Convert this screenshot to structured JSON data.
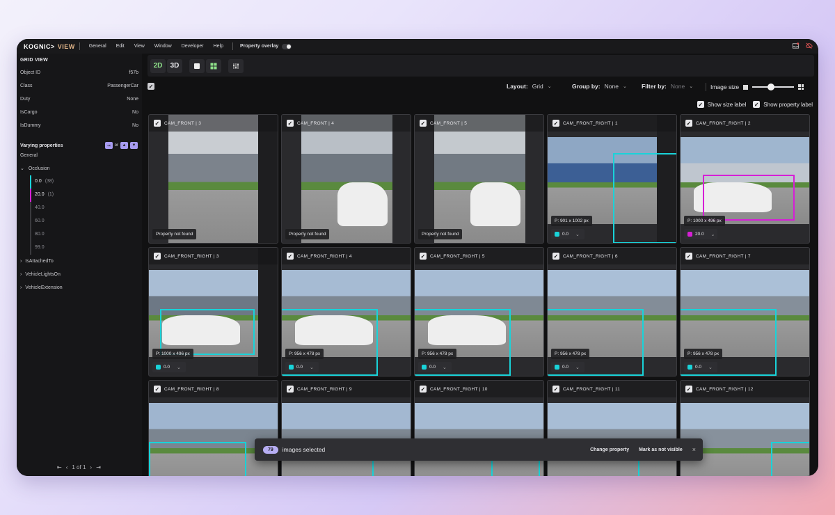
{
  "menubar": {
    "logo": "KOGNIC",
    "logo_suffix": "VIEW",
    "items": [
      "General",
      "Edit",
      "View",
      "Window",
      "Developer",
      "Help"
    ],
    "overlay_label": "Property overlay",
    "overlay_on": false
  },
  "sidebar": {
    "title": "GRID VIEW",
    "properties": [
      {
        "key": "Object ID",
        "value": "f57b"
      },
      {
        "key": "Class",
        "value": "PassengerCar"
      },
      {
        "key": "Duty",
        "value": "None"
      },
      {
        "key": "IsCargo",
        "value": "No"
      },
      {
        "key": "IsDummy",
        "value": "No"
      }
    ],
    "varying_title": "Varying properties",
    "or_label": "or",
    "group_label": "General",
    "occlusion_label": "Occlusion",
    "occlusion_values": [
      {
        "value": "0.0",
        "count": "(38)",
        "color": "#19d3d9"
      },
      {
        "value": "20.0",
        "count": "(1)",
        "color": "#d61fd6"
      },
      {
        "value": "40.0",
        "count": ""
      },
      {
        "value": "60.0",
        "count": ""
      },
      {
        "value": "80.0",
        "count": ""
      },
      {
        "value": "99.0",
        "count": ""
      }
    ],
    "collapsed_groups": [
      "IsAttachedTo",
      "VehicleLightsOn",
      "VehicleExtension"
    ],
    "pager": "1 of 1"
  },
  "toolbar": {
    "btn_2d": "2D",
    "btn_3d": "3D"
  },
  "options": {
    "layout_label": "Layout:",
    "layout_value": "Grid",
    "group_label": "Group by:",
    "group_value": "None",
    "filter_label": "Filter by:",
    "filter_value": "None",
    "image_size_label": "Image size",
    "image_size_level": 0.4,
    "show_size_label": "Show size label",
    "show_property_label": "Show property label"
  },
  "colors": {
    "cyan": "#19d3d9",
    "magenta": "#d61fd6",
    "accent": "#b7aef3"
  },
  "cards": [
    {
      "title": "CAM_FRONT | 3",
      "note": "Property not found"
    },
    {
      "title": "CAM_FRONT | 4",
      "note": "Property not found"
    },
    {
      "title": "CAM_FRONT | 5",
      "note": "Property not found"
    },
    {
      "title": "CAM_FRONT_RIGHT | 1",
      "size": "P: 901 x 1002 px",
      "value": "0.0",
      "color": "#19d3d9"
    },
    {
      "title": "CAM_FRONT_RIGHT | 2",
      "size": "P: 1000 x 496 px",
      "value": "20.0",
      "color": "#d61fd6"
    },
    {
      "title": "CAM_FRONT_RIGHT | 3",
      "size": "P: 1000 x 496 px",
      "value": "0.0",
      "color": "#19d3d9"
    },
    {
      "title": "CAM_FRONT_RIGHT | 4",
      "size": "P: 956 x 478 px",
      "value": "0.0",
      "color": "#19d3d9"
    },
    {
      "title": "CAM_FRONT_RIGHT | 5",
      "size": "P: 956 x 478 px",
      "value": "0.0",
      "color": "#19d3d9"
    },
    {
      "title": "CAM_FRONT_RIGHT | 6",
      "size": "P: 956 x 478 px",
      "value": "0.0",
      "color": "#19d3d9"
    },
    {
      "title": "CAM_FRONT_RIGHT | 7",
      "size": "P: 956 x 478 px",
      "value": "0.0",
      "color": "#19d3d9"
    },
    {
      "title": "CAM_FRONT_RIGHT | 8"
    },
    {
      "title": "CAM_FRONT_RIGHT | 9"
    },
    {
      "title": "CAM_FRONT_RIGHT | 10"
    },
    {
      "title": "CAM_FRONT_RIGHT | 11"
    },
    {
      "title": "CAM_FRONT_RIGHT | 12"
    }
  ],
  "selection": {
    "count": "79",
    "text": "images selected",
    "change_property": "Change property",
    "mark_not_visible": "Mark as not visible",
    "close": "×"
  }
}
